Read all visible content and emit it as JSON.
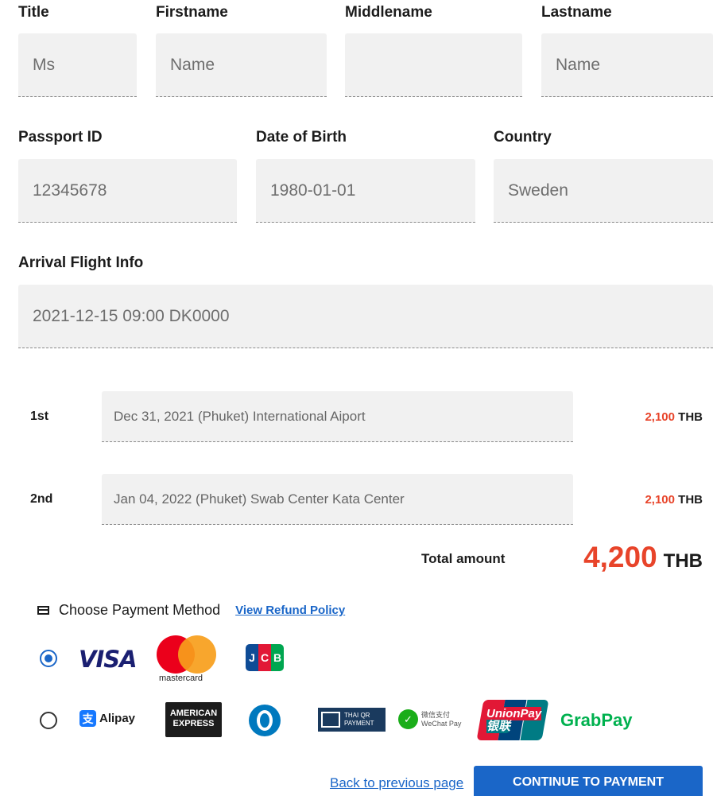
{
  "personal": {
    "labels": {
      "title": "Title",
      "firstname": "Firstname",
      "middlename": "Middlename",
      "lastname": "Lastname",
      "passport": "Passport ID",
      "dob": "Date of Birth",
      "country": "Country",
      "arrival": "Arrival Flight Info"
    },
    "values": {
      "title": "Ms",
      "firstname": "Name",
      "middlename": "",
      "lastname": "Name",
      "passport": "12345678",
      "dob": "1980-01-01",
      "country": "Sweden",
      "arrival": "2021-12-15 09:00 DK0000"
    }
  },
  "tests": [
    {
      "ordinal": "1st",
      "description": "Dec 31, 2021 (Phuket) International Aiport",
      "price": "2,100",
      "currency": "THB"
    },
    {
      "ordinal": "2nd",
      "description": "Jan 04, 2022 (Phuket) Swab Center Kata Center",
      "price": "2,100",
      "currency": "THB"
    }
  ],
  "total": {
    "label": "Total amount",
    "value": "4,200",
    "currency": "THB"
  },
  "payment": {
    "heading": "Choose Payment Method",
    "refund_link": "View Refund Policy",
    "group1_selected": true,
    "group2_selected": false,
    "logos": {
      "visa": "VISA",
      "mastercard": "mastercard",
      "jcb": [
        "J",
        "C",
        "B"
      ],
      "alipay": "Alipay",
      "alipay_glyph": "支",
      "amex": [
        "AMERICAN",
        "EXPRESS"
      ],
      "thaiqr": [
        "THAI QR",
        "PAYMENT"
      ],
      "wechat": [
        "微信支付",
        "WeChat Pay"
      ],
      "unionpay": [
        "UnionPay",
        "银联"
      ],
      "grabpay": "GrabPay"
    }
  },
  "actions": {
    "back": "Back to previous page",
    "continue": "CONTINUE TO PAYMENT"
  },
  "colors": {
    "accent": "#1a66c8",
    "price": "#e8442a",
    "field_bg": "#f1f1f1"
  },
  "icons": [
    "credit-card-icon",
    "radio-selected-icon",
    "radio-unselected-icon"
  ]
}
